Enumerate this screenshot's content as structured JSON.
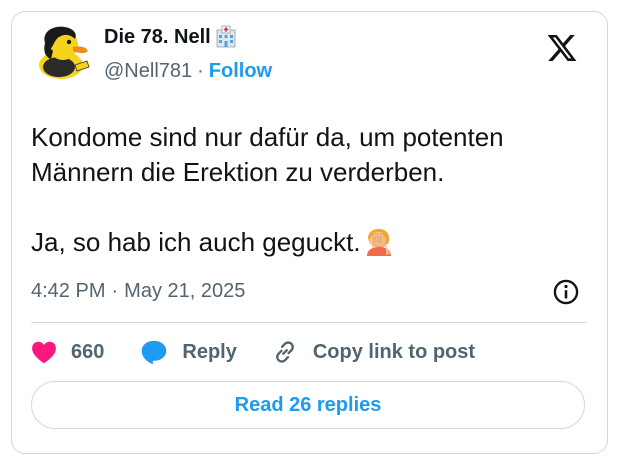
{
  "author": {
    "display_name": "Die 78. Nell",
    "name_emoji": "hospital-icon",
    "handle": "@Nell781",
    "separator": "·",
    "follow_label": "Follow",
    "avatar": "rubber-duck-avatar"
  },
  "tweet": {
    "lines": [
      "Kondome sind nur dafür da, um potenten",
      "Männern die Erektion zu verderben."
    ],
    "second_paragraph": "Ja, so hab ich auch geguckt.",
    "trailing_emoji": "facepalm-icon"
  },
  "meta": {
    "time": "4:42 PM",
    "separator": "·",
    "date": "May 21, 2025"
  },
  "actions": {
    "like_count": "660",
    "reply_label": "Reply",
    "copy_label": "Copy link to post"
  },
  "footer": {
    "read_replies_label": "Read 26 replies"
  },
  "colors": {
    "accent": "#1d9bf0",
    "like": "#f91880",
    "text": "#0f1419",
    "muted": "#536471",
    "border": "#cfd9de"
  }
}
